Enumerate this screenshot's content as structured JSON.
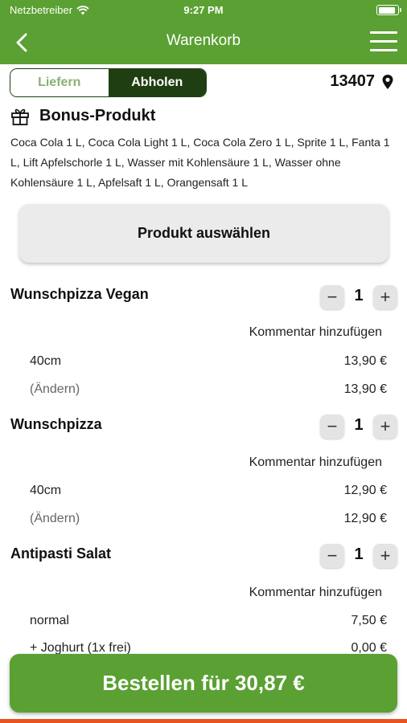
{
  "status_bar": {
    "carrier": "Netzbetreiber",
    "time": "9:27 PM",
    "wifi_icon": "wifi-icon",
    "battery_icon": "battery-icon"
  },
  "header": {
    "title": "Warenkorb",
    "back_icon": "chevron-left-icon",
    "menu_icon": "hamburger-menu-icon"
  },
  "delivery_mode": {
    "options": [
      "Liefern",
      "Abholen"
    ],
    "selected": "Abholen",
    "postcode": "13407",
    "location_icon": "location-pin-icon"
  },
  "bonus": {
    "title": "Bonus-Produkt",
    "icon": "gift-icon",
    "description": "Coca Cola 1 L, Coca Cola Light 1 L, Coca Cola Zero 1 L, Sprite 1 L, Fanta 1 L, Lift Apfelschorle 1 L, Wasser mit Kohlensäure 1 L, Wasser ohne Kohlensäure 1 L, Apfelsaft 1 L, Orangensaft 1 L",
    "button_label": "Produkt auswählen"
  },
  "cart": {
    "items": [
      {
        "name": "Wunschpizza Vegan",
        "quantity": "1",
        "comment_label": "Kommentar hinzufügen",
        "lines": [
          {
            "label": "40cm",
            "price": "13,90 €"
          },
          {
            "label": "(Ändern)",
            "price": "13,90 €"
          }
        ]
      },
      {
        "name": "Wunschpizza",
        "quantity": "1",
        "comment_label": "Kommentar hinzufügen",
        "lines": [
          {
            "label": "40cm",
            "price": "12,90 €"
          },
          {
            "label": "(Ändern)",
            "price": "12,90 €"
          }
        ]
      },
      {
        "name": "Antipasti Salat",
        "quantity": "1",
        "comment_label": "Kommentar hinzufügen",
        "lines": [
          {
            "label": "normal",
            "price": "7,50 €"
          },
          {
            "label": "+ Joghurt (1x frei)",
            "price": "0,00 €"
          }
        ]
      }
    ],
    "minus_symbol": "−",
    "plus_symbol": "+"
  },
  "checkout": {
    "button_label": "Bestellen für 30,87 €"
  },
  "colors": {
    "brand_green": "#5aa032",
    "dark_green": "#1f3f12",
    "accent_orange": "#e8531e"
  }
}
